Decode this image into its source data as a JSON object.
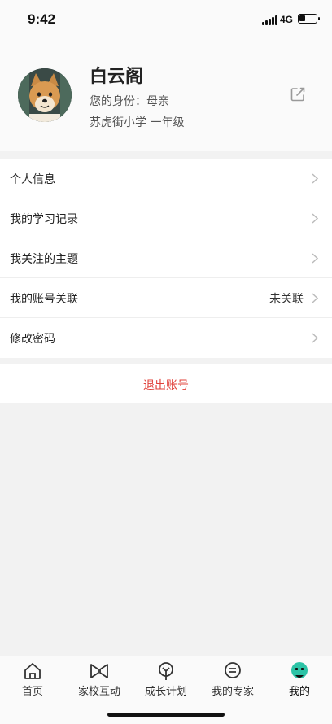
{
  "status": {
    "time": "9:42",
    "network": "4G",
    "battery_level": 0.35
  },
  "profile": {
    "name": "白云阁",
    "role": "您的身份：母亲",
    "school": "苏虎街小学 一年级",
    "avatar_icon": "shiba-dog-avatar",
    "edit_icon": "edit-icon"
  },
  "menu": [
    {
      "label": "个人信息",
      "value": ""
    },
    {
      "label": "我的学习记录",
      "value": ""
    },
    {
      "label": "我关注的主题",
      "value": ""
    },
    {
      "label": "我的账号关联",
      "value": "未关联"
    },
    {
      "label": "修改密码",
      "value": ""
    }
  ],
  "logout": {
    "label": "退出账号",
    "color": "#e0403a"
  },
  "tabs": [
    {
      "label": "首页",
      "icon": "home-icon"
    },
    {
      "label": "家校互动",
      "icon": "bowtie-icon"
    },
    {
      "label": "成长计划",
      "icon": "sprout-icon"
    },
    {
      "label": "我的专家",
      "icon": "chat-bubble-icon"
    },
    {
      "label": "我的",
      "icon": "smiley-icon",
      "active": true,
      "accent": "#2cc3a6"
    }
  ]
}
